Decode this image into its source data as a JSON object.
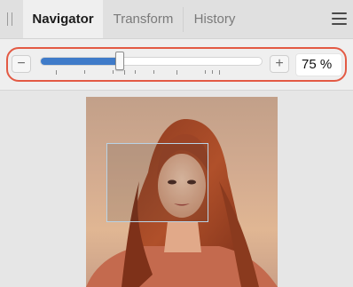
{
  "tabs": [
    {
      "label": "Navigator",
      "active": true
    },
    {
      "label": "Transform",
      "active": false
    },
    {
      "label": "History",
      "active": false
    }
  ],
  "icons": {
    "grip": "grip-handle-icon",
    "menu": "hamburger-menu-icon",
    "zoom_out": "minus-icon",
    "zoom_in": "plus-icon"
  },
  "zoom": {
    "out_label": "−",
    "in_label": "+",
    "value_text": "75 %",
    "slider_fraction": 0.36
  },
  "colors": {
    "accent": "#3f7bc9",
    "highlight": "#e35a44",
    "viewport_frame": "#b9d3e6"
  }
}
